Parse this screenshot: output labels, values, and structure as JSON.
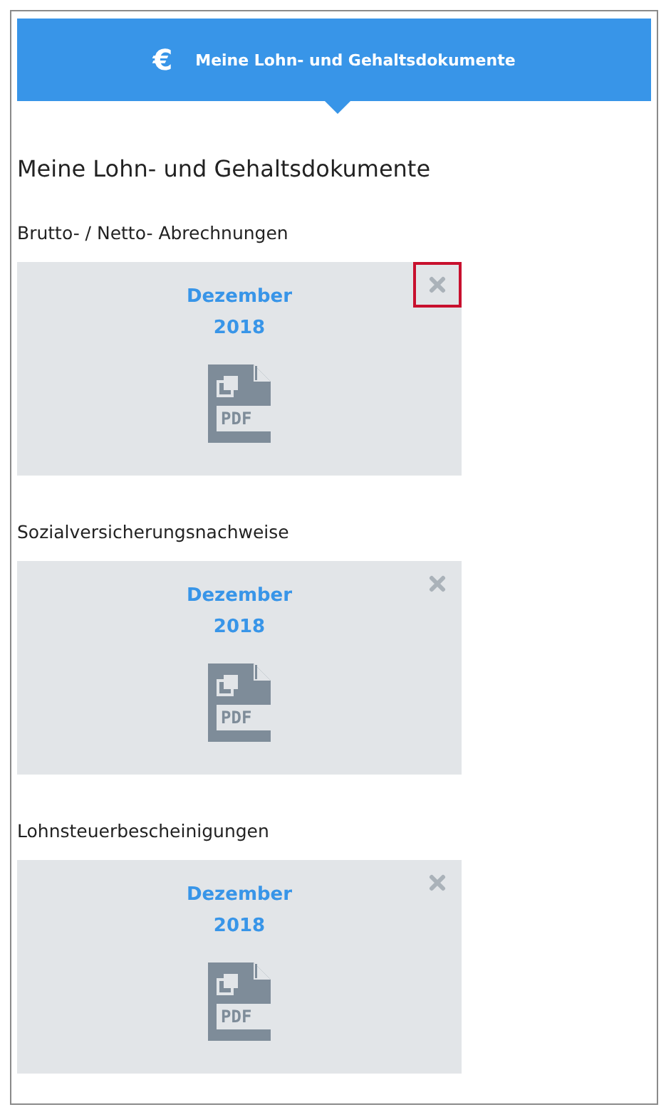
{
  "header": {
    "icon": "€",
    "title": "Meine Lohn- und Gehaltsdokumente"
  },
  "heading": "Meine Lohn- und Gehaltsdokumente",
  "sections": [
    {
      "label": "Brutto- / Netto- Abrechnungen",
      "document": {
        "month": "Dezember",
        "year": "2018",
        "file_type": "PDF",
        "close_focused": true
      }
    },
    {
      "label": "Sozialversicherungsnachweise",
      "document": {
        "month": "Dezember",
        "year": "2018",
        "file_type": "PDF",
        "close_focused": false
      }
    },
    {
      "label": "Lohnsteuerbescheinigungen",
      "document": {
        "month": "Dezember",
        "year": "2018",
        "file_type": "PDF",
        "close_focused": false
      }
    }
  ]
}
